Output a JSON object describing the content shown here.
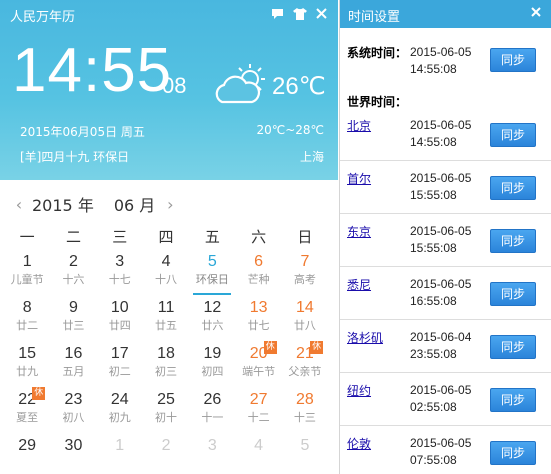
{
  "app": {
    "title": "人民万年历"
  },
  "clock": {
    "time": "14:55",
    "seconds": "08"
  },
  "weather": {
    "temp": "26℃",
    "range": "20℃~28℃",
    "city": "上海",
    "icon": "partly-cloudy-icon"
  },
  "date": {
    "line": "2015年06月05日  周五",
    "lunar": "[羊]四月十九 环保日"
  },
  "nav": {
    "prev": "‹",
    "next": "›",
    "year": "2015",
    "year_unit": "年",
    "month": "06",
    "month_unit": "月"
  },
  "weekdays": [
    "一",
    "二",
    "三",
    "四",
    "五",
    "六",
    "日"
  ],
  "days": [
    {
      "n": "1",
      "l": "儿童节"
    },
    {
      "n": "2",
      "l": "十六"
    },
    {
      "n": "3",
      "l": "十七"
    },
    {
      "n": "4",
      "l": "十八"
    },
    {
      "n": "5",
      "l": "环保日",
      "today": true
    },
    {
      "n": "6",
      "l": "芒种",
      "we": true
    },
    {
      "n": "7",
      "l": "高考",
      "we": true
    },
    {
      "n": "8",
      "l": "廿二"
    },
    {
      "n": "9",
      "l": "廿三"
    },
    {
      "n": "10",
      "l": "廿四"
    },
    {
      "n": "11",
      "l": "廿五"
    },
    {
      "n": "12",
      "l": "廿六"
    },
    {
      "n": "13",
      "l": "廿七",
      "we": true
    },
    {
      "n": "14",
      "l": "廿八",
      "we": true
    },
    {
      "n": "15",
      "l": "廿九"
    },
    {
      "n": "16",
      "l": "五月"
    },
    {
      "n": "17",
      "l": "初二"
    },
    {
      "n": "18",
      "l": "初三"
    },
    {
      "n": "19",
      "l": "初四"
    },
    {
      "n": "20",
      "l": "端午节",
      "we": true,
      "hol": "休"
    },
    {
      "n": "21",
      "l": "父亲节",
      "we": true,
      "hol": "休"
    },
    {
      "n": "22",
      "l": "夏至",
      "hol": "休"
    },
    {
      "n": "23",
      "l": "初八"
    },
    {
      "n": "24",
      "l": "初九"
    },
    {
      "n": "25",
      "l": "初十"
    },
    {
      "n": "26",
      "l": "十一"
    },
    {
      "n": "27",
      "l": "十二",
      "we": true
    },
    {
      "n": "28",
      "l": "十三",
      "we": true
    },
    {
      "n": "29",
      "l": ""
    },
    {
      "n": "30",
      "l": ""
    },
    {
      "n": "1",
      "l": "",
      "other": true
    },
    {
      "n": "2",
      "l": "",
      "other": true
    },
    {
      "n": "3",
      "l": "",
      "other": true
    },
    {
      "n": "4",
      "l": "",
      "other": true
    },
    {
      "n": "5",
      "l": "",
      "other": true
    }
  ],
  "time_settings": {
    "title": "时间设置",
    "system_label": "系统时间：",
    "system_date": "2015-06-05",
    "system_time": "14:55:08",
    "world_label": "世界时间：",
    "sync_label": "同步",
    "cities": [
      {
        "name": "北京",
        "date": "2015-06-05",
        "time": "14:55:08"
      },
      {
        "name": "首尔",
        "date": "2015-06-05",
        "time": "15:55:08"
      },
      {
        "name": "东京",
        "date": "2015-06-05",
        "time": "15:55:08"
      },
      {
        "name": "悉尼",
        "date": "2015-06-05",
        "time": "16:55:08"
      },
      {
        "name": "洛杉矶",
        "date": "2015-06-04",
        "time": "23:55:08"
      },
      {
        "name": "纽约",
        "date": "2015-06-05",
        "time": "02:55:08"
      },
      {
        "name": "伦敦",
        "date": "2015-06-05",
        "time": "07:55:08"
      }
    ]
  }
}
